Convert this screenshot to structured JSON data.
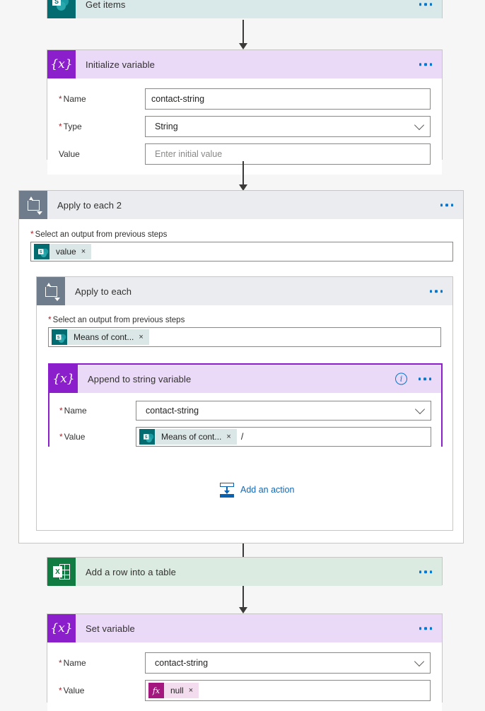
{
  "flow": {
    "nodes": [
      {
        "id": "get-items",
        "title": "Get items",
        "icon": "sharepoint-icon",
        "type": "sharepoint"
      },
      {
        "id": "initialize-variable",
        "title": "Initialize variable",
        "icon": "variable-icon",
        "type": "variable",
        "fields": [
          {
            "label": "Name",
            "required": true,
            "value": "contact-string",
            "control": "text"
          },
          {
            "label": "Type",
            "required": true,
            "value": "String",
            "control": "dropdown"
          },
          {
            "label": "Value",
            "required": false,
            "value": "",
            "placeholder": "Enter initial value",
            "control": "text"
          }
        ]
      },
      {
        "id": "apply-to-each-2",
        "title": "Apply to each 2",
        "icon": "loop-icon",
        "type": "loop",
        "output_label": "Select an output from previous steps",
        "output_required": true,
        "token": {
          "text": "value",
          "icon": "sharepoint-icon"
        }
      },
      {
        "id": "apply-to-each",
        "title": "Apply to each",
        "icon": "loop-icon",
        "type": "loop",
        "output_label": "Select an output from previous steps",
        "output_required": true,
        "token": {
          "text": "Means of cont...",
          "icon": "sharepoint-icon"
        }
      },
      {
        "id": "append-to-string-variable",
        "title": "Append to string variable",
        "icon": "variable-icon",
        "type": "variable",
        "selected": true,
        "has_info_icon": true,
        "fields": [
          {
            "label": "Name",
            "required": true,
            "value": "contact-string",
            "control": "dropdown"
          },
          {
            "label": "Value",
            "required": true,
            "control": "token",
            "token": {
              "text": "Means of cont...",
              "icon": "sharepoint-icon"
            },
            "trailing_text": "/"
          }
        ]
      },
      {
        "id": "add-a-row-into-a-table",
        "title": "Add a row into a table",
        "icon": "excel-icon",
        "type": "excel"
      },
      {
        "id": "set-variable",
        "title": "Set variable",
        "icon": "variable-icon",
        "type": "variable",
        "fields": [
          {
            "label": "Name",
            "required": true,
            "value": "contact-string",
            "control": "dropdown"
          },
          {
            "label": "Value",
            "required": true,
            "control": "token",
            "token": {
              "text": "null",
              "icon": "function-icon"
            }
          }
        ]
      }
    ],
    "add_action_label": "Add an action",
    "sharepoint_glyph_letter": "S",
    "excel_glyph_letter": "X",
    "variable_glyph": "{x}",
    "function_glyph": "fx",
    "token_remove_glyph": "×"
  },
  "colors": {
    "sharepoint": "#036C70",
    "variable": "#8A1FCB",
    "excel": "#107C41",
    "loop": "#6e7c8c",
    "accent_blue": "#0078D4",
    "link_blue": "#1267b5",
    "required_red": "#A4262C",
    "selection_purple": "#8A1FCB"
  }
}
